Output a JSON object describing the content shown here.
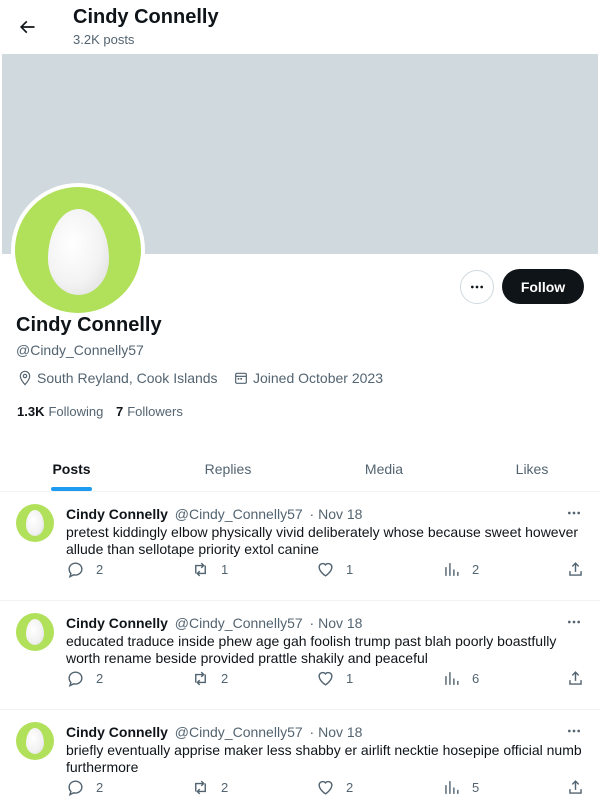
{
  "header": {
    "title": "Cindy Connelly",
    "posts_count": "3.2K posts"
  },
  "profile": {
    "name": "Cindy Connelly",
    "handle": "@Cindy_Connelly57",
    "location": "South Reyland, Cook Islands",
    "joined": "Joined October 2023",
    "following_count": "1.3K",
    "following_label": "Following",
    "followers_count": "7",
    "followers_label": "Followers",
    "follow_label": "Follow"
  },
  "tabs": [
    {
      "label": "Posts",
      "active": true
    },
    {
      "label": "Replies",
      "active": false
    },
    {
      "label": "Media",
      "active": false
    },
    {
      "label": "Likes",
      "active": false
    }
  ],
  "posts": [
    {
      "name": "Cindy Connelly",
      "handle": "@Cindy_Connelly57",
      "date": "· Nov 18",
      "text": "pretest kiddingly elbow physically vivid deliberately whose because sweet however allude than sellotape priority extol canine",
      "replies": "2",
      "reposts": "1",
      "likes": "1",
      "views": "2"
    },
    {
      "name": "Cindy Connelly",
      "handle": "@Cindy_Connelly57",
      "date": "· Nov 18",
      "text": "educated traduce inside phew age gah foolish trump past blah poorly boastfully worth rename beside provided prattle shakily and peaceful",
      "replies": "2",
      "reposts": "2",
      "likes": "1",
      "views": "6"
    },
    {
      "name": "Cindy Connelly",
      "handle": "@Cindy_Connelly57",
      "date": "· Nov 18",
      "text": "briefly eventually apprise maker less shabby er airlift necktie hosepipe official numb furthermore",
      "replies": "2",
      "reposts": "2",
      "likes": "2",
      "views": "5"
    }
  ],
  "colors": {
    "accent": "#1d9bf0",
    "banner": "#cfd9de",
    "avatar_bg": "#b1e05a",
    "text_primary": "#0f1419",
    "text_secondary": "#536471"
  }
}
